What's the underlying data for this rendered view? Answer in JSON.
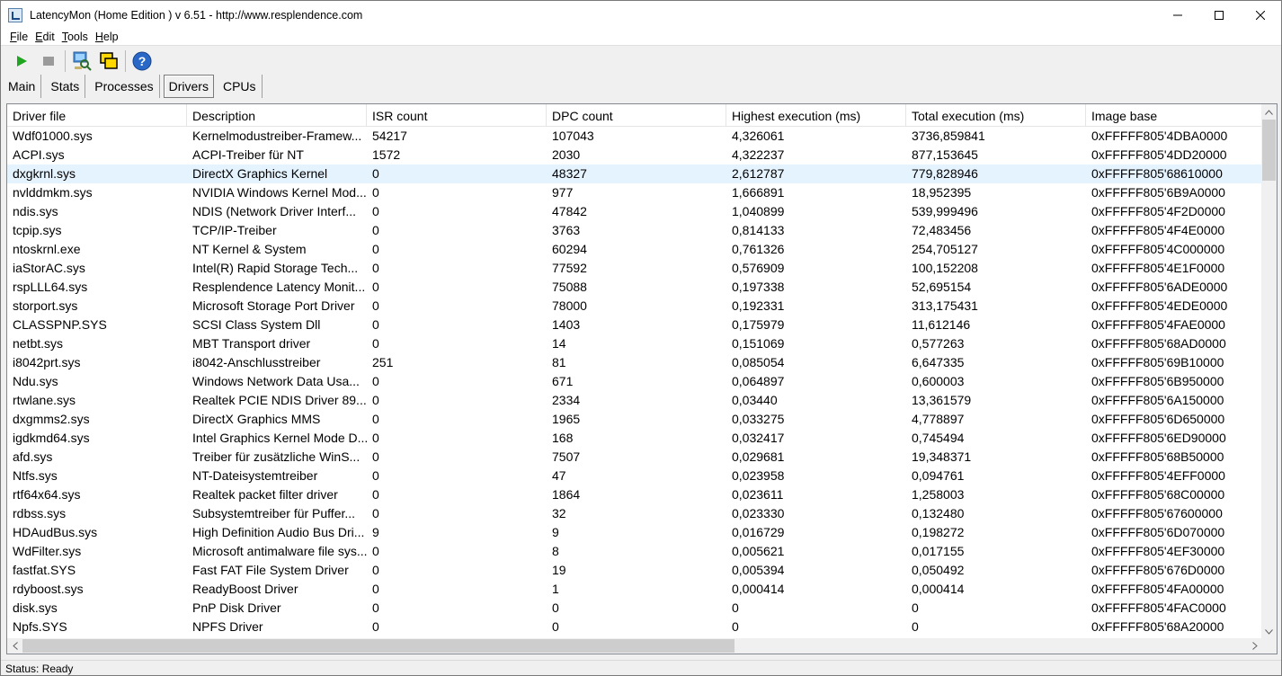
{
  "window": {
    "title": "LatencyMon  (Home Edition )  v 6.51 - http://www.resplendence.com"
  },
  "menu": [
    {
      "key": "F",
      "rest": "ile"
    },
    {
      "key": "E",
      "rest": "dit"
    },
    {
      "key": "T",
      "rest": "ools"
    },
    {
      "key": "H",
      "rest": "elp"
    }
  ],
  "toolbar": {
    "icons": [
      "play-icon",
      "stop-icon",
      "monitor-search-icon",
      "windows-icon",
      "help-icon"
    ]
  },
  "tabs": [
    {
      "label": "Main",
      "active": false
    },
    {
      "label": "Stats",
      "active": false
    },
    {
      "label": "Processes",
      "active": false
    },
    {
      "label": "Drivers",
      "active": true
    },
    {
      "label": "CPUs",
      "active": false
    }
  ],
  "table": {
    "columns": [
      "Driver file",
      "Description",
      "ISR count",
      "DPC count",
      "Highest execution (ms)",
      "Total execution (ms)",
      "Image base"
    ],
    "selected_row": 2,
    "rows": [
      [
        "Wdf01000.sys",
        "Kernelmodustreiber-Framew...",
        "54217",
        "107043",
        "4,326061",
        "3736,859841",
        "0xFFFFF805'4DBA0000"
      ],
      [
        "ACPI.sys",
        "ACPI-Treiber für NT",
        "1572",
        "2030",
        "4,322237",
        "877,153645",
        "0xFFFFF805'4DD20000"
      ],
      [
        "dxgkrnl.sys",
        "DirectX Graphics Kernel",
        "0",
        "48327",
        "2,612787",
        "779,828946",
        "0xFFFFF805'68610000"
      ],
      [
        "nvlddmkm.sys",
        "NVIDIA Windows Kernel Mod...",
        "0",
        "977",
        "1,666891",
        "18,952395",
        "0xFFFFF805'6B9A0000"
      ],
      [
        "ndis.sys",
        "NDIS (Network Driver Interf...",
        "0",
        "47842",
        "1,040899",
        "539,999496",
        "0xFFFFF805'4F2D0000"
      ],
      [
        "tcpip.sys",
        "TCP/IP-Treiber",
        "0",
        "3763",
        "0,814133",
        "72,483456",
        "0xFFFFF805'4F4E0000"
      ],
      [
        "ntoskrnl.exe",
        "NT Kernel & System",
        "0",
        "60294",
        "0,761326",
        "254,705127",
        "0xFFFFF805'4C000000"
      ],
      [
        "iaStorAC.sys",
        "Intel(R) Rapid Storage Tech...",
        "0",
        "77592",
        "0,576909",
        "100,152208",
        "0xFFFFF805'4E1F0000"
      ],
      [
        "rspLLL64.sys",
        "Resplendence Latency Monit...",
        "0",
        "75088",
        "0,197338",
        "52,695154",
        "0xFFFFF805'6ADE0000"
      ],
      [
        "storport.sys",
        "Microsoft Storage Port Driver",
        "0",
        "78000",
        "0,192331",
        "313,175431",
        "0xFFFFF805'4EDE0000"
      ],
      [
        "CLASSPNP.SYS",
        "SCSI Class System Dll",
        "0",
        "1403",
        "0,175979",
        "11,612146",
        "0xFFFFF805'4FAE0000"
      ],
      [
        "netbt.sys",
        "MBT Transport driver",
        "0",
        "14",
        "0,151069",
        "0,577263",
        "0xFFFFF805'68AD0000"
      ],
      [
        "i8042prt.sys",
        "i8042-Anschlusstreiber",
        "251",
        "81",
        "0,085054",
        "6,647335",
        "0xFFFFF805'69B10000"
      ],
      [
        "Ndu.sys",
        "Windows Network Data Usa...",
        "0",
        "671",
        "0,064897",
        "0,600003",
        "0xFFFFF805'6B950000"
      ],
      [
        "rtwlane.sys",
        "Realtek PCIE NDIS Driver 89...",
        "0",
        "2334",
        "0,03440",
        "13,361579",
        "0xFFFFF805'6A150000"
      ],
      [
        "dxgmms2.sys",
        "DirectX Graphics MMS",
        "0",
        "1965",
        "0,033275",
        "4,778897",
        "0xFFFFF805'6D650000"
      ],
      [
        "igdkmd64.sys",
        "Intel Graphics Kernel Mode D...",
        "0",
        "168",
        "0,032417",
        "0,745494",
        "0xFFFFF805'6ED90000"
      ],
      [
        "afd.sys",
        "Treiber für zusätzliche WinS...",
        "0",
        "7507",
        "0,029681",
        "19,348371",
        "0xFFFFF805'68B50000"
      ],
      [
        "Ntfs.sys",
        "NT-Dateisystemtreiber",
        "0",
        "47",
        "0,023958",
        "0,094761",
        "0xFFFFF805'4EFF0000"
      ],
      [
        "rtf64x64.sys",
        "Realtek packet filter driver",
        "0",
        "1864",
        "0,023611",
        "1,258003",
        "0xFFFFF805'68C00000"
      ],
      [
        "rdbss.sys",
        "Subsystemtreiber für Puffer...",
        "0",
        "32",
        "0,023330",
        "0,132480",
        "0xFFFFF805'67600000"
      ],
      [
        "HDAudBus.sys",
        "High Definition Audio Bus Dri...",
        "9",
        "9",
        "0,016729",
        "0,198272",
        "0xFFFFF805'6D070000"
      ],
      [
        "WdFilter.sys",
        "Microsoft antimalware file sys...",
        "0",
        "8",
        "0,005621",
        "0,017155",
        "0xFFFFF805'4EF30000"
      ],
      [
        "fastfat.SYS",
        "Fast FAT File System Driver",
        "0",
        "19",
        "0,005394",
        "0,050492",
        "0xFFFFF805'676D0000"
      ],
      [
        "rdyboost.sys",
        "ReadyBoost Driver",
        "0",
        "1",
        "0,000414",
        "0,000414",
        "0xFFFFF805'4FA00000"
      ],
      [
        "disk.sys",
        "PnP Disk Driver",
        "0",
        "0",
        "0",
        "0",
        "0xFFFFF805'4FAC0000"
      ],
      [
        "Npfs.SYS",
        "NPFS Driver",
        "0",
        "0",
        "0",
        "0",
        "0xFFFFF805'68A20000"
      ]
    ]
  },
  "status": {
    "text": "Status: Ready"
  }
}
